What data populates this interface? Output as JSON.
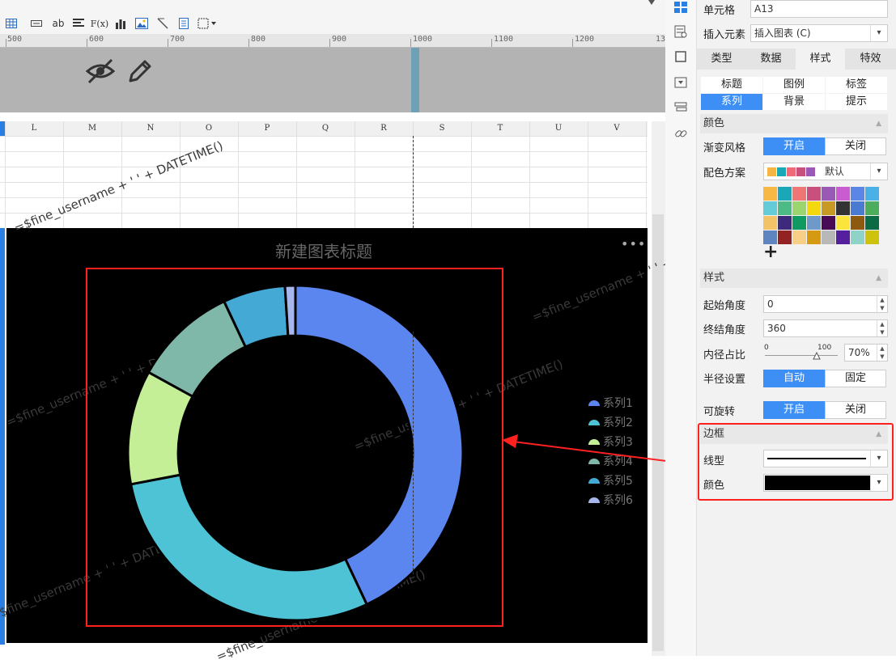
{
  "ruler": {
    "ticks": [
      "500",
      "600",
      "700",
      "800",
      "900",
      "1000",
      "1100",
      "1200",
      "13"
    ]
  },
  "columns": [
    "L",
    "M",
    "N",
    "O",
    "P",
    "Q",
    "R",
    "S",
    "T",
    "U",
    "V"
  ],
  "chart": {
    "title": "新建图表标题",
    "more": "•••",
    "watermark": "=$fine_username + ' ' + DATETIME()",
    "legend": [
      {
        "label": "系列1",
        "color": "#5b86f0"
      },
      {
        "label": "系列2",
        "color": "#4fc3d6"
      },
      {
        "label": "系列3",
        "color": "#c5ef97"
      },
      {
        "label": "系列4",
        "color": "#7fb8a8"
      },
      {
        "label": "系列5",
        "color": "#45a9d6"
      },
      {
        "label": "系列6",
        "color": "#a7b7ee"
      }
    ]
  },
  "chart_data": {
    "type": "pie",
    "title": "新建图表标题",
    "inner_radius_percent": 70,
    "start_angle": 0,
    "end_angle": 360,
    "series": [
      {
        "name": "系列1",
        "value": 43,
        "color": "#5b86f0"
      },
      {
        "name": "系列2",
        "value": 29,
        "color": "#4fc3d6"
      },
      {
        "name": "系列3",
        "value": 11,
        "color": "#c5ef97"
      },
      {
        "name": "系列4",
        "value": 10,
        "color": "#7fb8a8"
      },
      {
        "name": "系列5",
        "value": 6,
        "color": "#45a9d6"
      },
      {
        "name": "系列6",
        "value": 1,
        "color": "#a7b7ee"
      }
    ]
  },
  "toolbar": {
    "ab_label": "ab",
    "fx_label": "F(x)"
  },
  "panel": {
    "cell_label": "单元格",
    "cell_value": "A13",
    "insert_label": "插入元素",
    "insert_value": "插入图表 (C)",
    "tabs": [
      "类型",
      "数据",
      "样式",
      "特效"
    ],
    "subtabs_row1": [
      "标题",
      "图例",
      "标签"
    ],
    "subtabs_row2": [
      "系列",
      "背景",
      "提示"
    ],
    "color_section": "颜色",
    "gradient_label": "渐变风格",
    "on": "开启",
    "off": "关闭",
    "scheme_label": "配色方案",
    "scheme_value": "默认",
    "scheme_swatches": [
      "#f5b643",
      "#1aa8b8",
      "#ef6b7a",
      "#c94f7d",
      "#9b59b6"
    ],
    "palette": [
      "#f7b844",
      "#1aa8b8",
      "#f07676",
      "#c94f7d",
      "#9b59b6",
      "#c95cd0",
      "#5c86e6",
      "#4ab1e6",
      "#64cbd8",
      "#4dbb86",
      "#9bd56f",
      "#f4d80e",
      "#c79a26",
      "#333333",
      "#4a7bd0",
      "#4cae5d",
      "#f2c467",
      "#3d2a7c",
      "#0f9a62",
      "#6e99c9",
      "#4a0b55",
      "#fbe43c",
      "#8d5a0f",
      "#0b6b45",
      "#5f85c0",
      "#932222",
      "#f7cf86",
      "#d69a12",
      "#b8b8b8",
      "#55209e",
      "#8fd3c8",
      "#cdc20e"
    ],
    "add_symbol": "+",
    "style_section": "样式",
    "start_angle_label": "起始角度",
    "start_angle_value": "0",
    "end_angle_label": "终结角度",
    "end_angle_value": "360",
    "inner_label": "内径占比",
    "inner_min": "0",
    "inner_max": "100",
    "inner_value": "70%",
    "radius_label": "半径设置",
    "radius_auto": "自动",
    "radius_fixed": "固定",
    "rotatable_label": "可旋转",
    "border_section": "边框",
    "line_type_label": "线型",
    "border_color_label": "颜色"
  }
}
